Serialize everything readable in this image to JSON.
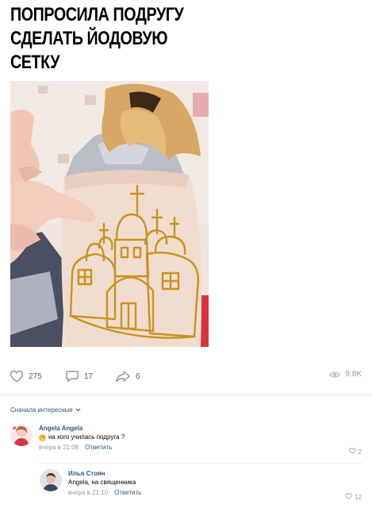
{
  "post": {
    "caption": "ПОПРОСИЛА ПОДРУГУ\nСДЕЛАТЬ ЙОДОВУЮ\nСЕТКУ"
  },
  "actions": {
    "likes": "275",
    "comments": "17",
    "shares": "6",
    "views": "9.8K"
  },
  "comments": {
    "sort_label": "Сначала интересные",
    "items": [
      {
        "author": "Angela Angela",
        "text": "на кого училась подруга ?",
        "time": "вчера в 21:08",
        "reply_label": "Ответить",
        "likes": "2"
      },
      {
        "author": "Илья Стоян",
        "text": "Angela, на священника",
        "time": "вчера в 21:10",
        "reply_label": "Ответить",
        "likes": "12"
      }
    ]
  },
  "colors": {
    "link": "#2a5885",
    "muted": "#939ba6",
    "iodine": "#c9941f"
  },
  "icons": [
    "heart-icon",
    "comment-icon",
    "share-icon",
    "eye-icon",
    "chevron-down-icon",
    "smile-emoji-icon"
  ]
}
